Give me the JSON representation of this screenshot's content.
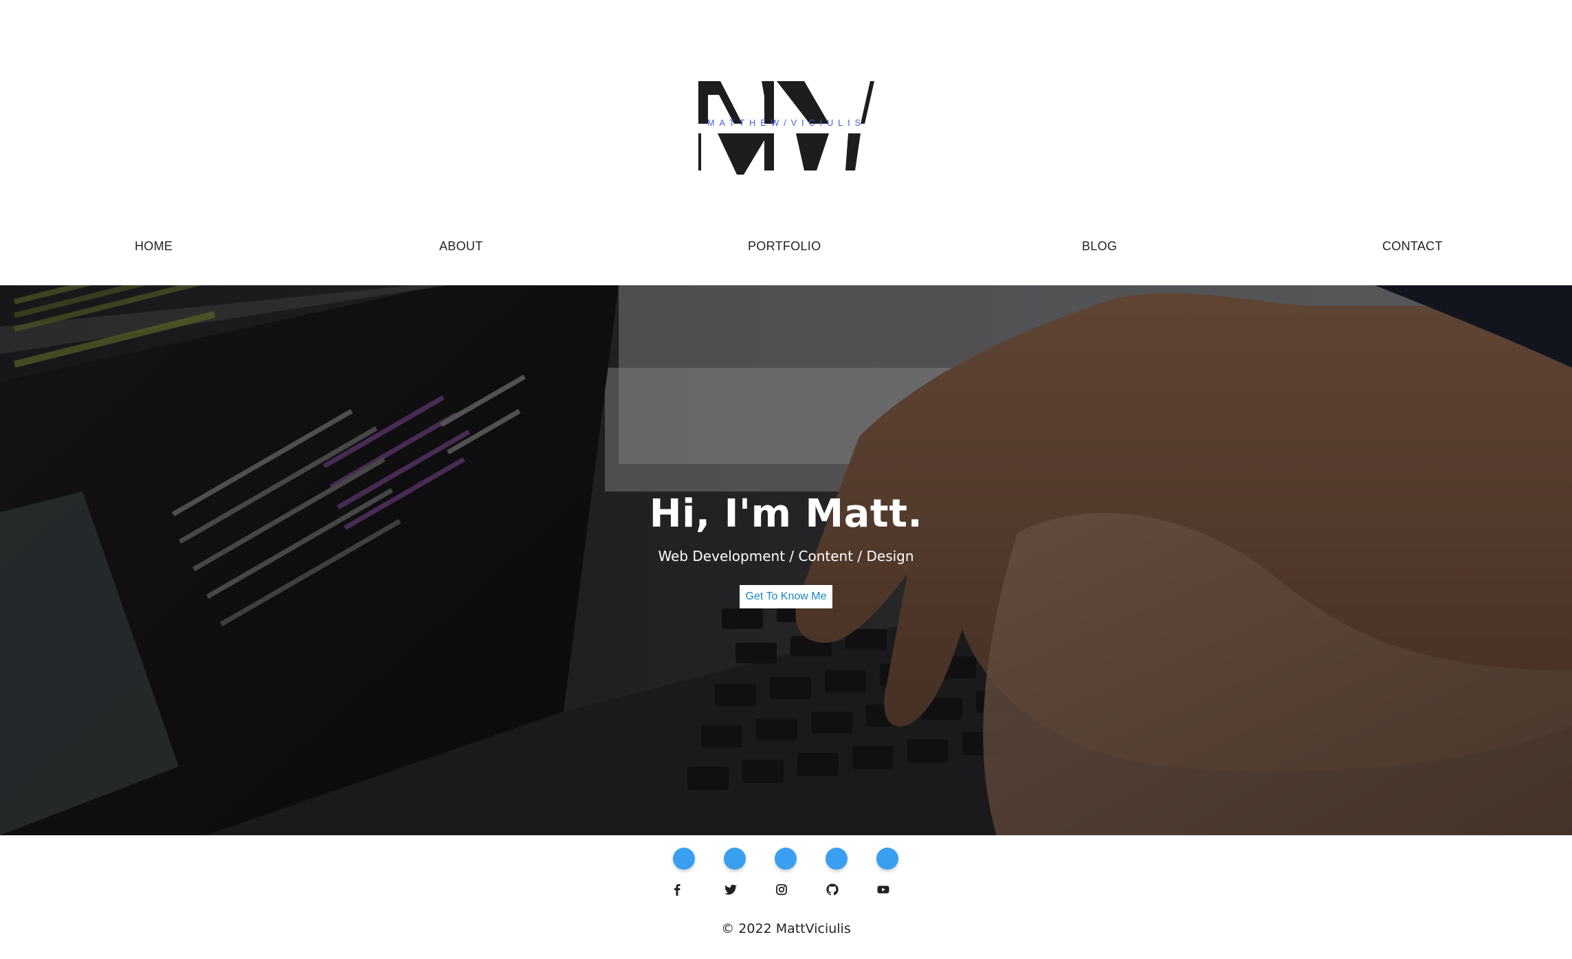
{
  "header": {
    "logo_monogram": "MV",
    "logo_caption": "MATTHEW/VICIULIS"
  },
  "nav": {
    "items": [
      {
        "label": "HOME"
      },
      {
        "label": "ABOUT"
      },
      {
        "label": "PORTFOLIO"
      },
      {
        "label": "BLOG"
      },
      {
        "label": "CONTACT"
      }
    ]
  },
  "hero": {
    "title": "Hi, I'm Matt.",
    "subtitle": "Web Development / Content / Design",
    "cta_label": "Get To Know Me"
  },
  "footer": {
    "social_icons": [
      "facebook-icon",
      "twitter-icon",
      "instagram-icon",
      "github-icon",
      "youtube-icon"
    ],
    "copyright": "© 2022 MattViciulis"
  },
  "colors": {
    "accent_blue": "#3a9ff0",
    "logo_caption_blue": "#3e5be0",
    "cta_text": "#1a86c7",
    "text_dark": "#222222"
  }
}
